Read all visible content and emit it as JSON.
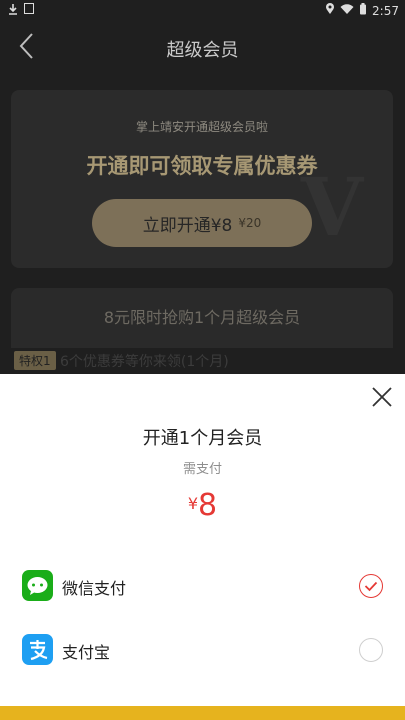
{
  "status_bar": {
    "time": "2:57",
    "battery_icon": "battery-icon",
    "wifi_icon": "wifi-icon",
    "location_icon": "location-icon"
  },
  "header": {
    "title": "超级会员",
    "back_icon": "chevron-left-icon"
  },
  "promo_card": {
    "subtitle": "掌上靖安开通超级会员啦",
    "headline": "开通即可领取专属优惠券",
    "button_label": "立即开通¥8",
    "button_original_price": "¥20",
    "watermark": "V"
  },
  "second_card": {
    "title": "8元限时抢购1个月超级会员"
  },
  "privilege": {
    "tag": "特权1",
    "text": "6个优惠券等你来领(1个月)"
  },
  "payment_sheet": {
    "close_icon": "close-icon",
    "title": "开通1个月会员",
    "subtitle": "需支付",
    "currency": "¥",
    "amount": "8",
    "methods": [
      {
        "label": "微信支付",
        "icon": "wechat-icon",
        "selected": true
      },
      {
        "label": "支付宝",
        "icon": "alipay-icon",
        "selected": false
      }
    ]
  },
  "colors": {
    "accent_red": "#e53935",
    "gold": "#7d7058",
    "wechat_green": "#1aad19",
    "alipay_blue": "#1e9ff2",
    "bottom_bar": "#e6b31e"
  }
}
